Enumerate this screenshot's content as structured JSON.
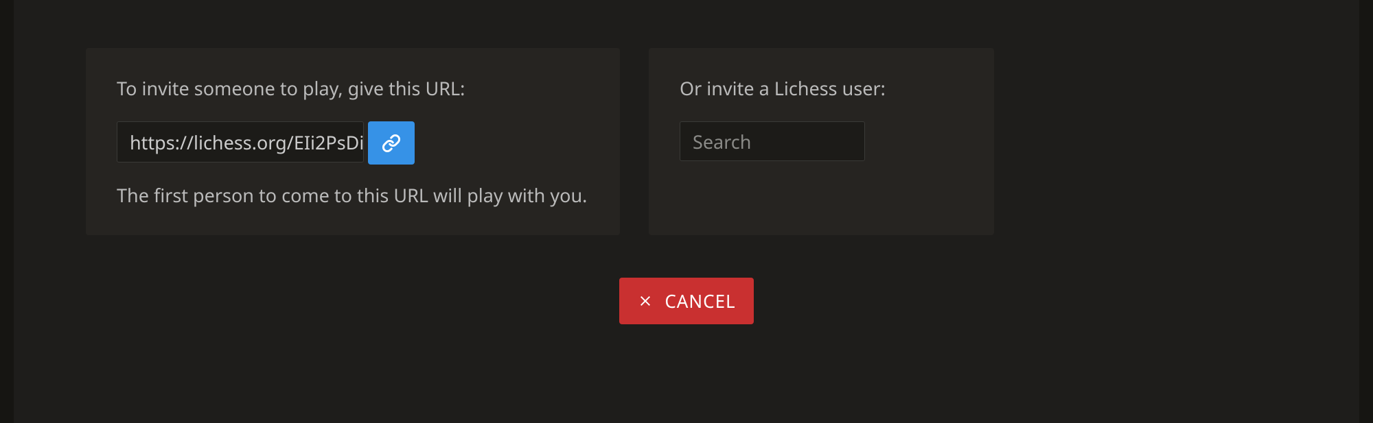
{
  "invitePanel": {
    "title": "To invite someone to play, give this URL:",
    "url": "https://lichess.org/EIi2PsDi",
    "hint": "The first person to come to this URL will play with you."
  },
  "userPanel": {
    "title": "Or invite a Lichess user:",
    "searchPlaceholder": "Search"
  },
  "cancel": {
    "label": "CANCEL"
  }
}
